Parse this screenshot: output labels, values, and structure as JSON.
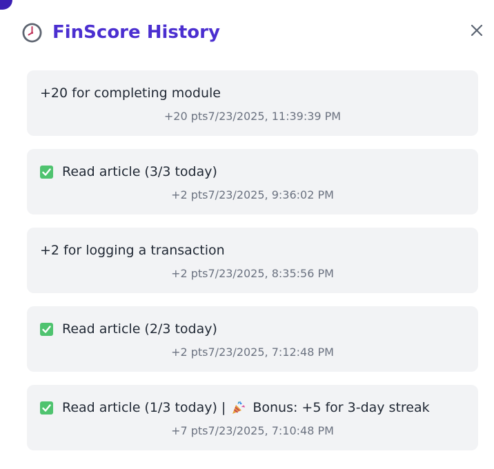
{
  "modal": {
    "title": "FinScore History",
    "title_icon": "clock-icon",
    "close_icon": "close-icon",
    "accent_color": "#4b2fd0"
  },
  "entries": [
    {
      "icon": "",
      "text": "+20 for completing module",
      "points": "+20 pts",
      "timestamp": "7/23/2025, 11:39:39 PM"
    },
    {
      "icon": "check-icon",
      "text": "Read article (3/3 today)",
      "points": "+2 pts",
      "timestamp": "7/23/2025, 9:36:02 PM"
    },
    {
      "icon": "",
      "text": "+2 for logging a transaction",
      "points": "+2 pts",
      "timestamp": "7/23/2025, 8:35:56 PM"
    },
    {
      "icon": "check-icon",
      "text": "Read article (2/3 today)",
      "points": "+2 pts",
      "timestamp": "7/23/2025, 7:12:48 PM"
    },
    {
      "icon": "check-icon",
      "text": "Read article (1/3 today) |",
      "bonus_icon": "party-popper-icon",
      "bonus_text": "Bonus: +5 for 3-day streak",
      "points": "+7 pts",
      "timestamp": "7/23/2025, 7:10:48 PM"
    }
  ]
}
